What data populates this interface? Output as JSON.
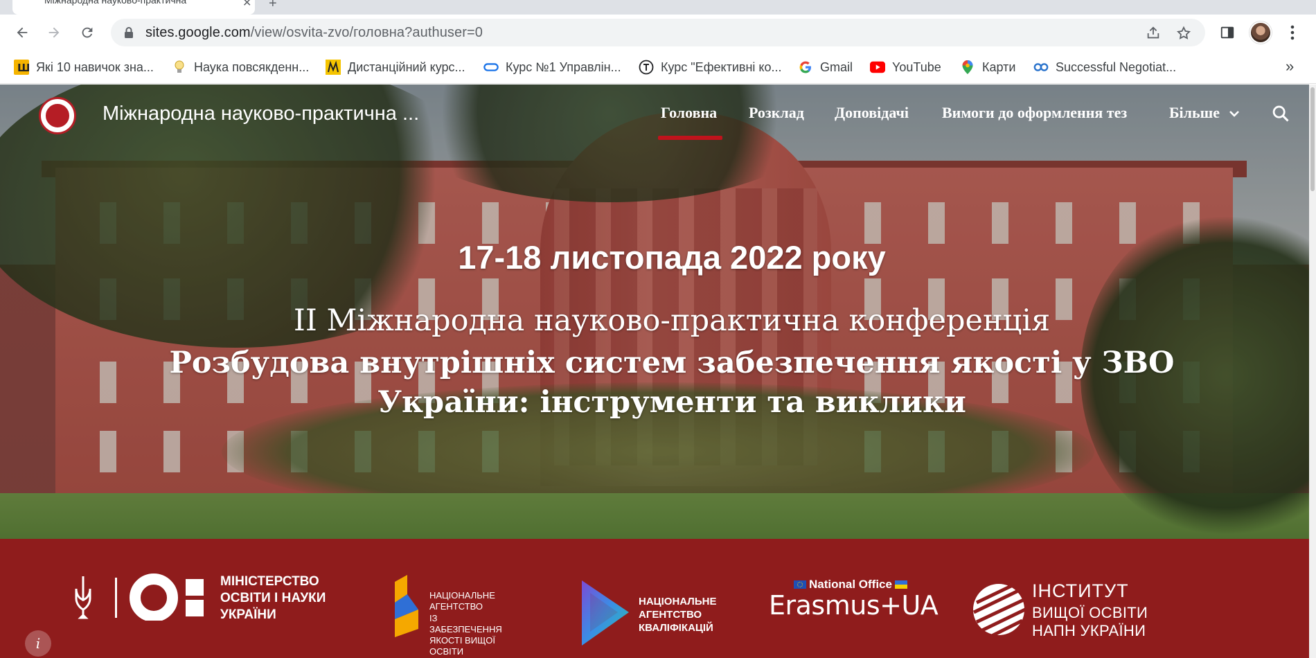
{
  "browser": {
    "tab_title": "Міжнародна науково-практична",
    "url_host": "sites.google.com",
    "url_path": "/view/osvita-zvo/головна?authuser=0",
    "bookmarks": [
      {
        "label": "Які 10 навичок зна...",
        "icon": "sh-logo-icon",
        "color": "#f5b400"
      },
      {
        "label": "Наука повсякденн...",
        "icon": "lightbulb-icon",
        "color": "#f2c94c"
      },
      {
        "label": "Дистанційний курс...",
        "icon": "prometheus-icon",
        "color": "#f5c400"
      },
      {
        "label": "Курс №1 Управлін...",
        "icon": "link-icon",
        "color": "#1a73e8"
      },
      {
        "label": "Курс \"Ефективні ко...",
        "icon": "t-circle-icon",
        "color": "#202124"
      },
      {
        "label": "Gmail",
        "icon": "google-icon",
        "color": "#4285f4"
      },
      {
        "label": "YouTube",
        "icon": "youtube-icon",
        "color": "#ff0000"
      },
      {
        "label": "Карти",
        "icon": "maps-pin-icon",
        "color": "#34a853"
      },
      {
        "label": "Successful Negotiat...",
        "icon": "coursera-icon",
        "color": "#2a73cc"
      }
    ],
    "more_bookmarks": "»"
  },
  "site": {
    "title": "Міжнародна науково-практична ...",
    "nav": [
      {
        "label": "Головна",
        "active": true
      },
      {
        "label": "Розклад",
        "active": false
      },
      {
        "label": "Доповідачі",
        "active": false
      },
      {
        "label": "Вимоги до оформлення тез",
        "active": false
      },
      {
        "label": "Більше",
        "active": false
      }
    ],
    "accent": "#c0131c"
  },
  "hero": {
    "date": "17-18 листопада 2022 року",
    "subtitle": "II Міжнародна науково-практична конференція",
    "title_line1": "Розбудова внутрішніх систем забезпечення якості у ЗВО",
    "title_line2": "України: інструменти та виклики"
  },
  "partners": {
    "background": "#8f1c1c",
    "mon": [
      "Міністерство",
      "освіти і науки",
      "України"
    ],
    "naqa": [
      "Національне",
      "агентство",
      "із забезпечення",
      "якості вищої освіти"
    ],
    "nqa": [
      "Національне",
      "агентство",
      "кваліфікацій"
    ],
    "erasmus_office": "National Office",
    "erasmus_name": "Erasmus+UA",
    "ihe": [
      "Інститут",
      "вищої освіти",
      "НАПН України"
    ]
  }
}
